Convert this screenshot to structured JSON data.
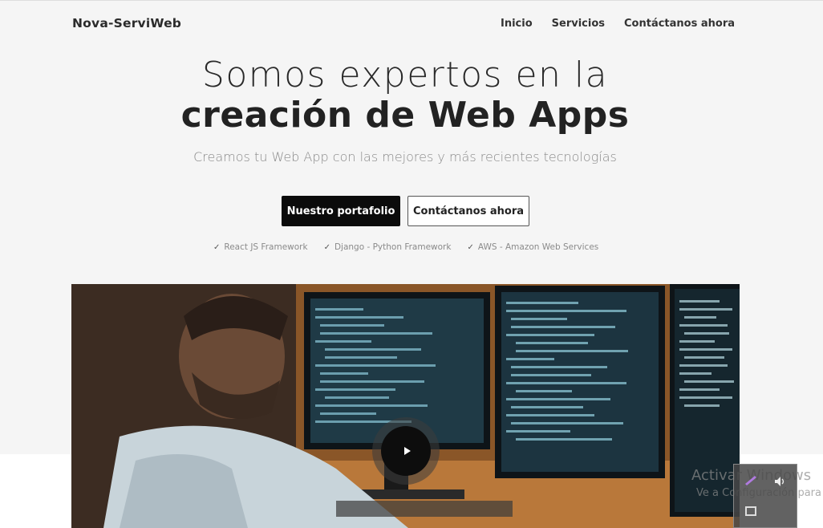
{
  "brand": {
    "name": "Nova-ServiWeb"
  },
  "nav": {
    "items": [
      "Inicio",
      "Servicios",
      "Contáctanos ahora"
    ]
  },
  "hero": {
    "headline_light": "Somos expertos en la",
    "headline_bold": "creación de Web Apps",
    "subtitle": "Creamos tu Web App con las mejores y más recientes tecnologías",
    "primary_button": "Nuestro portafolio",
    "secondary_button": "Contáctanos ahora",
    "features": [
      "React JS Framework",
      "Django - Python Framework",
      "AWS - Amazon Web Services"
    ]
  },
  "media": {
    "play_icon": "play-icon"
  },
  "windows_watermark": {
    "title": "Activar Windows",
    "subtitle": "Ve a Configuración para"
  },
  "colors": {
    "background": "#f5f5f5",
    "primary": "#0b0b0b",
    "text": "#222222"
  }
}
